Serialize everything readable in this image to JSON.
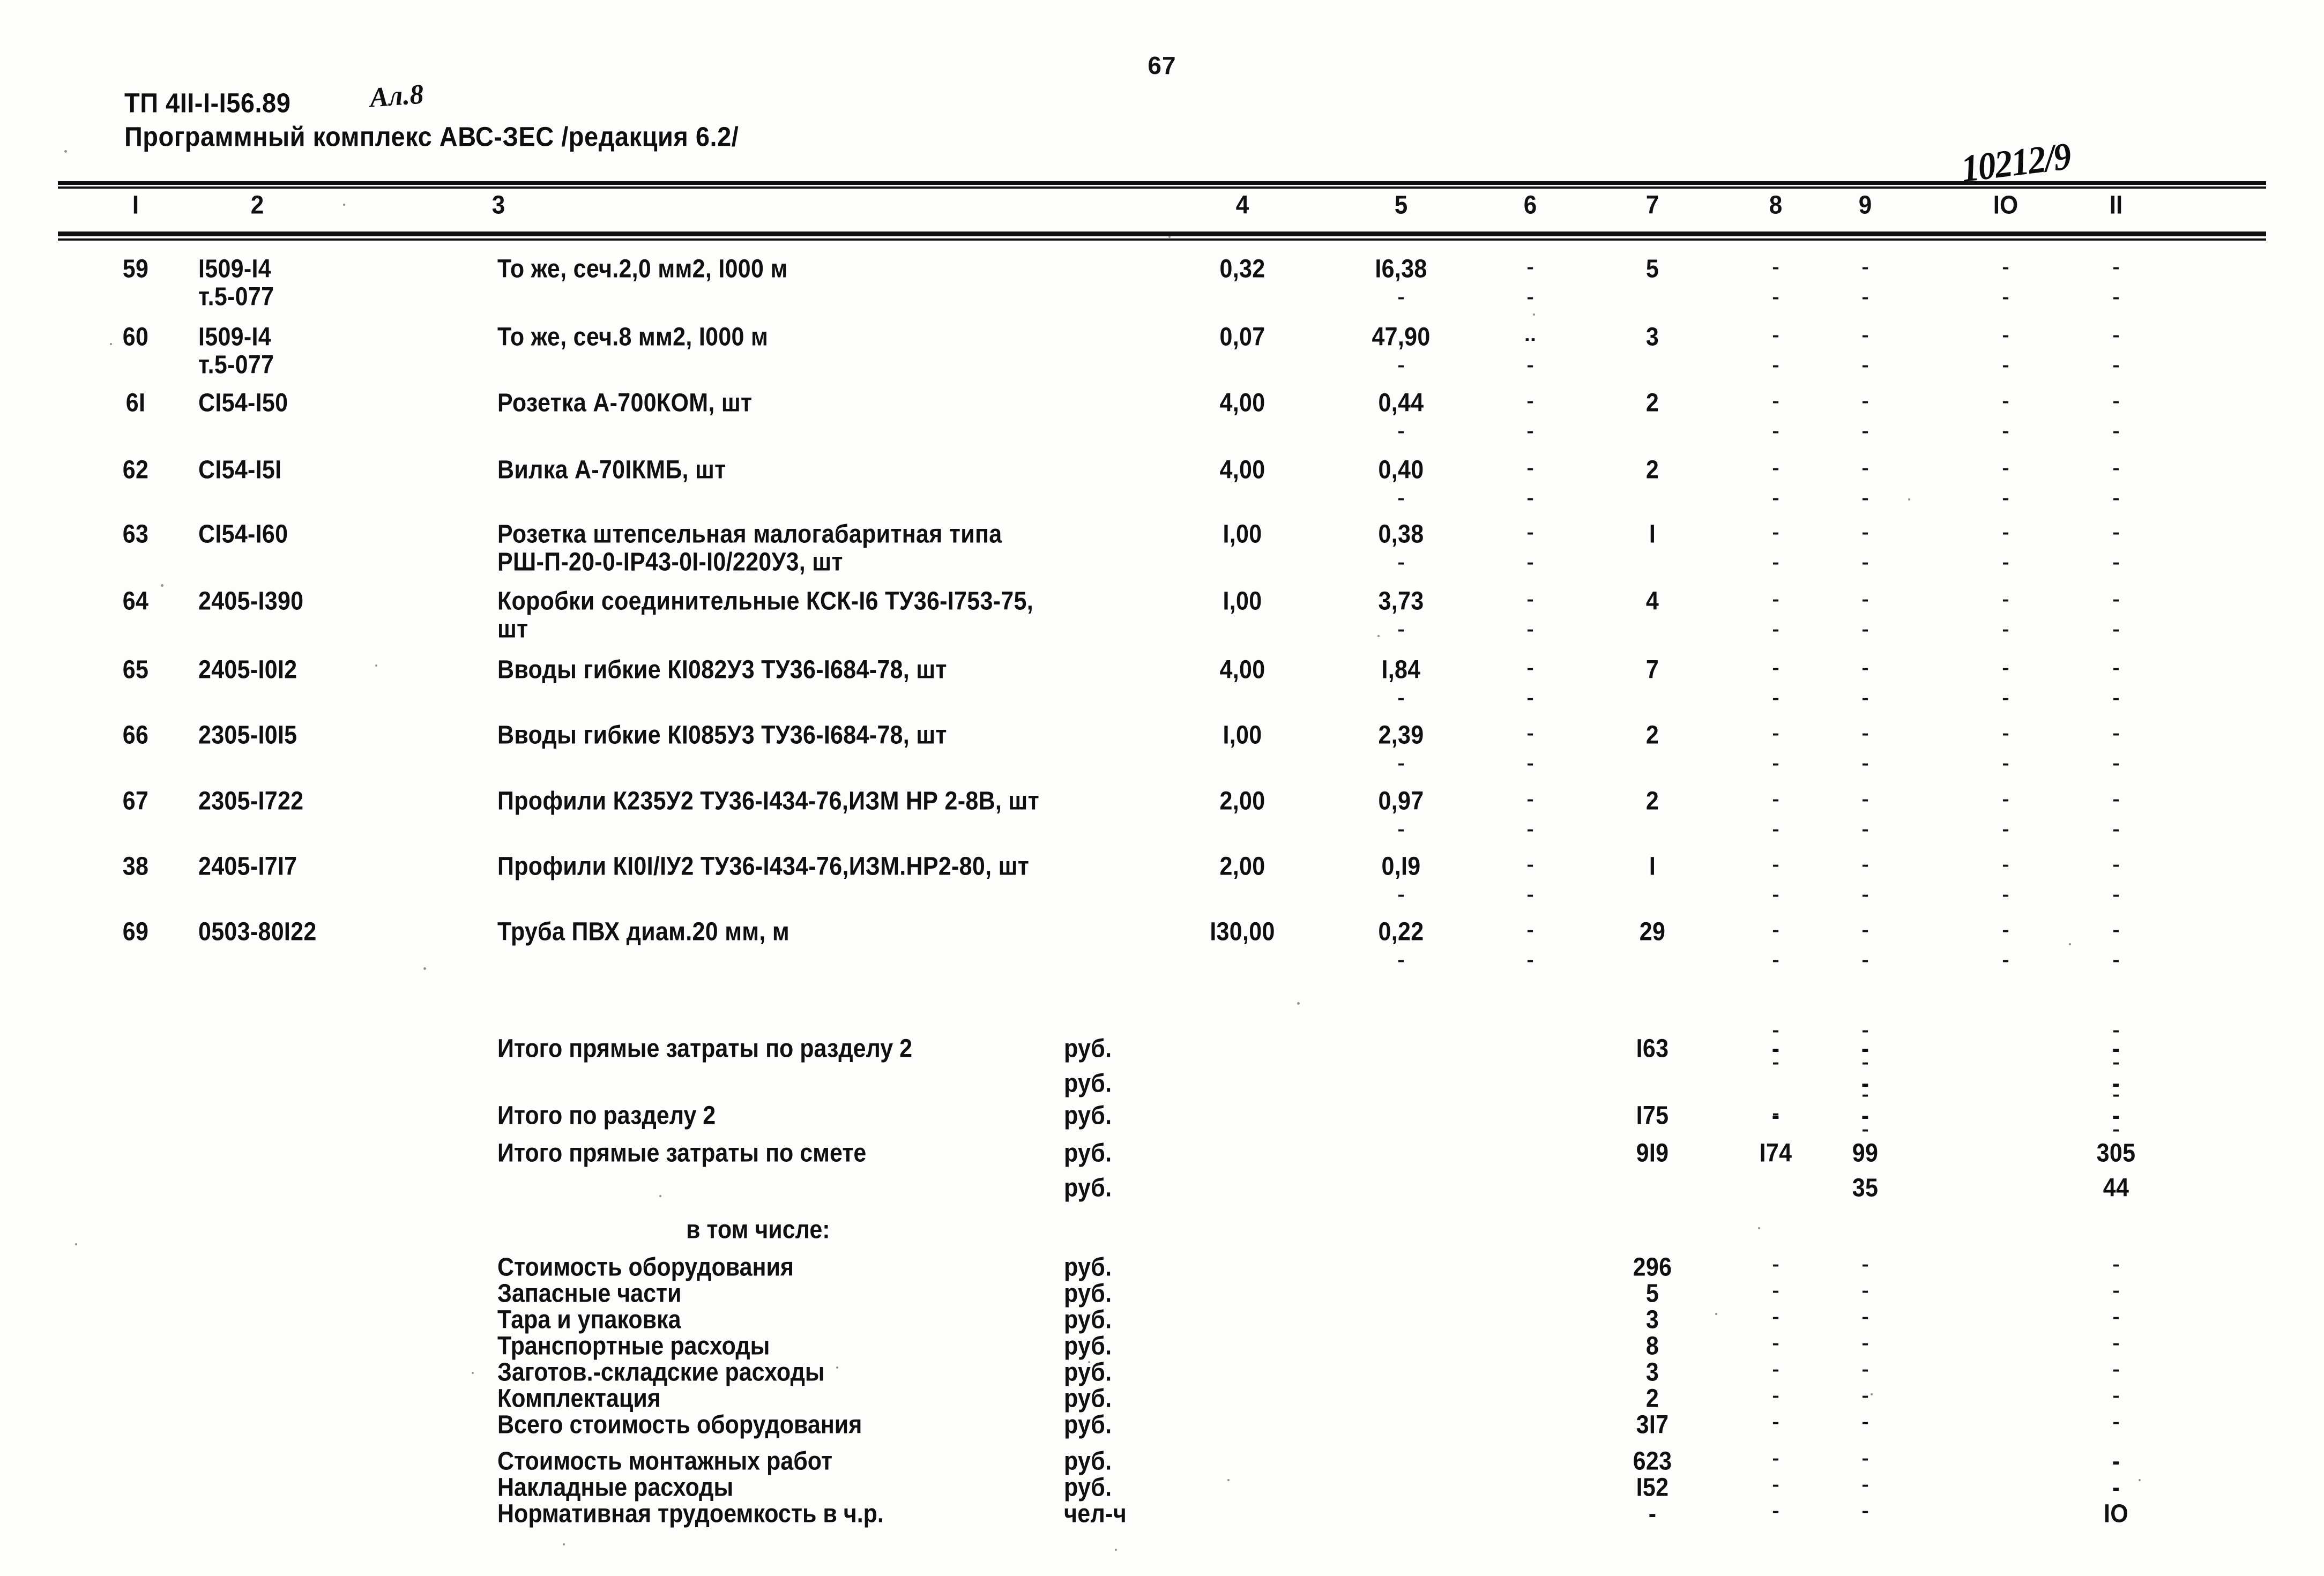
{
  "page": {
    "number": "67",
    "header_line1": "ТП 4II-I-I56.89",
    "header_line2": "Программный комплекс АВС-ЗЕС /редакция 6.2/",
    "annotation_album": "Ал.8",
    "annotation_number": "10212/9"
  },
  "table": {
    "column_headers": [
      "I",
      "2",
      "3",
      "4",
      "5",
      "6",
      "7",
      "8",
      "9",
      "IO",
      "II"
    ],
    "dash": "-",
    "rows": [
      {
        "n": "59",
        "code": "I509-I4",
        "code2": "т.5-077",
        "desc": "То же, сеч.2,0 мм2, I000 м",
        "c4": "0,32",
        "c5": "I6,38",
        "c6": "-",
        "c7": "5",
        "c8": "-",
        "c9": "-",
        "c10": "-",
        "c11": "-"
      },
      {
        "n": "60",
        "code": "I509-I4",
        "code2": "т.5-077",
        "desc": "То же, сеч.8 мм2, I000 м",
        "c4": "0,07",
        "c5": "47,90",
        "c6": "..",
        "c7": "3",
        "c8": "-",
        "c9": "-",
        "c10": "-",
        "c11": "-"
      },
      {
        "n": "6I",
        "code": "CI54-I50",
        "code2": "",
        "desc": "Розетка А-700КОМ, шт",
        "c4": "4,00",
        "c5": "0,44",
        "c6": "-",
        "c7": "2",
        "c8": "-",
        "c9": "-",
        "c10": "-",
        "c11": "-"
      },
      {
        "n": "62",
        "code": "CI54-I5I",
        "code2": "",
        "desc": "Вилка А-70IКМБ, шт",
        "c4": "4,00",
        "c5": "0,40",
        "c6": "-",
        "c7": "2",
        "c8": "-",
        "c9": "-",
        "c10": "-",
        "c11": "-"
      },
      {
        "n": "63",
        "code": "CI54-I60",
        "code2": "",
        "desc": "Розетка штепсельная малогабаритная типа",
        "desc2": "РШ-П-20-0-IР43-0I-I0/220У3, шт",
        "c4": "I,00",
        "c5": "0,38",
        "c6": "-",
        "c7": "I",
        "c8": "-",
        "c9": "-",
        "c10": "-",
        "c11": "-"
      },
      {
        "n": "64",
        "code": "2405-I390",
        "code2": "",
        "desc": "Коробки соединительные КСК-I6 ТУ36-I753-75,",
        "desc2": "шт",
        "c4": "I,00",
        "c5": "3,73",
        "c6": "-",
        "c7": "4",
        "c8": "-",
        "c9": "-",
        "c10": "-",
        "c11": "-"
      },
      {
        "n": "65",
        "code": "2405-I0I2",
        "code2": "",
        "desc": "Вводы гибкие КI082У3 ТУ36-I684-78, шт",
        "c4": "4,00",
        "c5": "I,84",
        "c6": "-",
        "c7": "7",
        "c8": "-",
        "c9": "-",
        "c10": "-",
        "c11": "-"
      },
      {
        "n": "66",
        "code": "2305-I0I5",
        "code2": "",
        "desc": "Вводы гибкие КI085У3 ТУ36-I684-78, шт",
        "c4": "I,00",
        "c5": "2,39",
        "c6": "-",
        "c7": "2",
        "c8": "-",
        "c9": "-",
        "c10": "-",
        "c11": "-"
      },
      {
        "n": "67",
        "code": "2305-I722",
        "code2": "",
        "desc": "Профили К235У2 ТУ36-I434-76,ИЗМ НР 2-8В, шт",
        "c4": "2,00",
        "c5": "0,97",
        "c6": "-",
        "c7": "2",
        "c8": "-",
        "c9": "-",
        "c10": "-",
        "c11": "-"
      },
      {
        "n": "38",
        "code": "2405-I7I7",
        "code2": "",
        "desc": "Профили КI0I/IУ2 ТУ36-I434-76,ИЗМ.НР2-80, шт",
        "c4": "2,00",
        "c5": "0,I9",
        "c6": "-",
        "c7": "I",
        "c8": "-",
        "c9": "-",
        "c10": "-",
        "c11": "-"
      },
      {
        "n": "69",
        "code": "0503-80I22",
        "code2": "",
        "desc": "Труба ПВХ диам.20 мм, м",
        "c4": "I30,00",
        "c5": "0,22",
        "c6": "-",
        "c7": "29",
        "c8": "-",
        "c9": "-",
        "c10": "-",
        "c11": "-"
      }
    ],
    "summary": [
      {
        "label": "Итого прямые затраты по разделу 2",
        "unit": "руб.",
        "c7": "I63",
        "c8": "-",
        "c9": "-",
        "c10": "",
        "c11": "-"
      },
      {
        "label": "",
        "unit": "руб.",
        "c7": "",
        "c8": "",
        "c9": "-",
        "c10": "",
        "c11": "-"
      },
      {
        "label": "Итого по разделу 2",
        "unit": "руб.",
        "c7": "I75",
        "c8": "-",
        "c9": "-",
        "c10": "",
        "c11": "-"
      },
      {
        "label": "Итого прямые затраты по смете",
        "unit": "руб.",
        "c7": "9I9",
        "c8": "I74",
        "c9": "99",
        "c10": "",
        "c11": "305"
      },
      {
        "label": "",
        "unit": "руб.",
        "c7": "",
        "c8": "",
        "c9": "35",
        "c10": "",
        "c11": "44"
      }
    ],
    "in_which_title": "в том числе:",
    "breakdown": [
      {
        "label": "Стоимость оборудования",
        "unit": "руб.",
        "c7": "296",
        "c8": "-",
        "c9": "-",
        "c11": "-"
      },
      {
        "label": "Запасные части",
        "unit": "руб.",
        "c7": "5",
        "c8": "-",
        "c9": "-",
        "c11": "-"
      },
      {
        "label": "Тара и упаковка",
        "unit": "руб.",
        "c7": "3",
        "c8": "-",
        "c9": "-",
        "c11": "-"
      },
      {
        "label": "Транспортные расходы",
        "unit": "руб.",
        "c7": "8",
        "c8": "-",
        "c9": "-",
        "c11": "-"
      },
      {
        "label": "Заготов.-складские расходы",
        "unit": "руб.",
        "c7": "3",
        "c8": "-",
        "c9": "-",
        "c11": "-"
      },
      {
        "label": "Комплектация",
        "unit": "руб.",
        "c7": "2",
        "c8": "-",
        "c9": "-",
        "c11": "-"
      },
      {
        "label": "Всего стоимость оборудования",
        "unit": "руб.",
        "c7": "3I7",
        "c8": "-",
        "c9": "-",
        "c11": "-"
      }
    ],
    "footer": [
      {
        "label": "Стоимость монтажных работ",
        "unit": "руб.",
        "c7": "623",
        "c8": "-",
        "c9": "-",
        "c11": "-"
      },
      {
        "label": "Накладные расходы",
        "unit": "руб.",
        "c7": "I52",
        "c8": "-",
        "c9": "-",
        "c11": "-"
      },
      {
        "label": "Нормативная трудоемкость в ч.р.",
        "unit": "чел-ч",
        "c7": "-",
        "c8": "-",
        "c9": "-",
        "c11": "IO"
      }
    ]
  }
}
